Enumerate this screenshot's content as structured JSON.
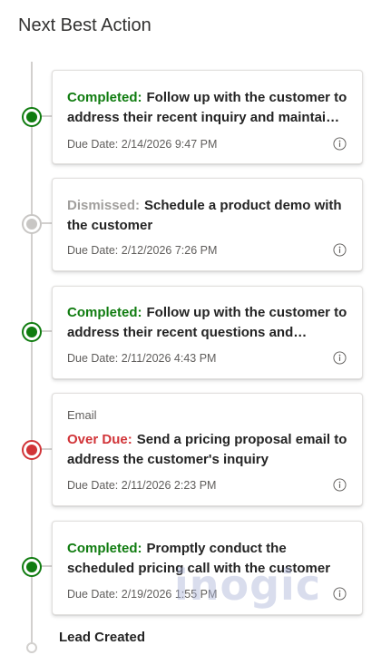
{
  "header": {
    "title": "Next Best Action"
  },
  "actions": [
    {
      "status": "Completed:",
      "text": "Follow up with the customer to address their recent inquiry and maintain engagement",
      "due": "Due Date: 2/14/2026 9:47 PM"
    },
    {
      "status": "Dismissed:",
      "text": "Schedule a product demo with the customer",
      "due": "Due Date: 2/12/2026 7:26 PM"
    },
    {
      "status": "Completed:",
      "text": "Follow up with the customer to address their recent questions and maintain engagement",
      "due": "Due Date: 2/11/2026 4:43 PM"
    },
    {
      "channel": "Email",
      "status": "Over Due:",
      "text": "Send a pricing proposal email to address the customer's inquiry",
      "due": "Due Date: 2/11/2026 2:23 PM"
    },
    {
      "status": "Completed:",
      "text": "Promptly conduct the scheduled pricing call with the customer",
      "due": "Due Date: 2/19/2026 1:55 PM"
    }
  ],
  "footer": {
    "lead_created": "Lead Created"
  },
  "watermark": "inogic",
  "colors": {
    "completed": "#107c10",
    "dismissed": "#a19f9d",
    "overdue": "#d13438",
    "timeline": "#d2d0ce"
  },
  "icons": {
    "info": "info-icon",
    "status_node": "status-node-icon"
  }
}
